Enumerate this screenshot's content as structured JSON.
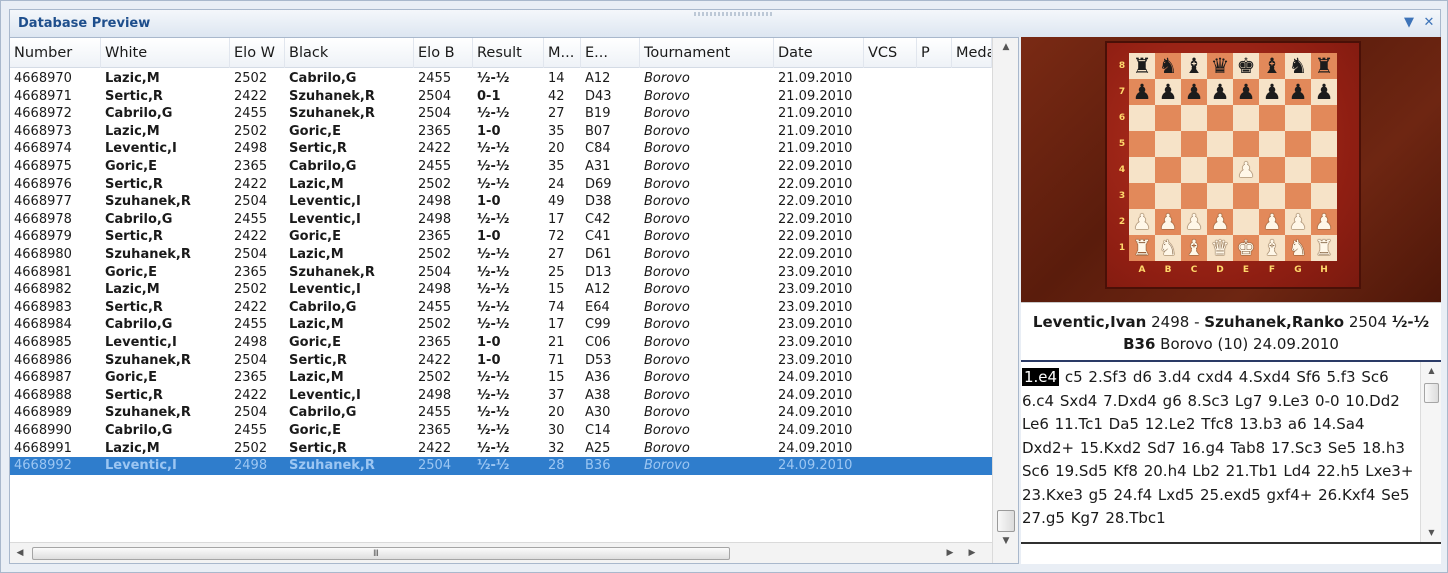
{
  "window": {
    "title": "Database Preview",
    "dropdown_icon": "▼",
    "close_icon": "✕"
  },
  "columns": [
    "Number",
    "White",
    "Elo W",
    "Black",
    "Elo B",
    "Result",
    "M...",
    "E...",
    "Tournament",
    "Date",
    "VCS",
    "P",
    "Meda"
  ],
  "rows": [
    [
      "4668970",
      "Lazic,M",
      "2502",
      "Cabrilo,G",
      "2455",
      "½-½",
      "14",
      "A12",
      "Borovo",
      "21.09.2010"
    ],
    [
      "4668971",
      "Sertic,R",
      "2422",
      "Szuhanek,R",
      "2504",
      "0-1",
      "42",
      "D43",
      "Borovo",
      "21.09.2010"
    ],
    [
      "4668972",
      "Cabrilo,G",
      "2455",
      "Szuhanek,R",
      "2504",
      "½-½",
      "27",
      "B19",
      "Borovo",
      "21.09.2010"
    ],
    [
      "4668973",
      "Lazic,M",
      "2502",
      "Goric,E",
      "2365",
      "1-0",
      "35",
      "B07",
      "Borovo",
      "21.09.2010"
    ],
    [
      "4668974",
      "Leventic,I",
      "2498",
      "Sertic,R",
      "2422",
      "½-½",
      "20",
      "C84",
      "Borovo",
      "21.09.2010"
    ],
    [
      "4668975",
      "Goric,E",
      "2365",
      "Cabrilo,G",
      "2455",
      "½-½",
      "35",
      "A31",
      "Borovo",
      "22.09.2010"
    ],
    [
      "4668976",
      "Sertic,R",
      "2422",
      "Lazic,M",
      "2502",
      "½-½",
      "24",
      "D69",
      "Borovo",
      "22.09.2010"
    ],
    [
      "4668977",
      "Szuhanek,R",
      "2504",
      "Leventic,I",
      "2498",
      "1-0",
      "49",
      "D38",
      "Borovo",
      "22.09.2010"
    ],
    [
      "4668978",
      "Cabrilo,G",
      "2455",
      "Leventic,I",
      "2498",
      "½-½",
      "17",
      "C42",
      "Borovo",
      "22.09.2010"
    ],
    [
      "4668979",
      "Sertic,R",
      "2422",
      "Goric,E",
      "2365",
      "1-0",
      "72",
      "C41",
      "Borovo",
      "22.09.2010"
    ],
    [
      "4668980",
      "Szuhanek,R",
      "2504",
      "Lazic,M",
      "2502",
      "½-½",
      "27",
      "D61",
      "Borovo",
      "22.09.2010"
    ],
    [
      "4668981",
      "Goric,E",
      "2365",
      "Szuhanek,R",
      "2504",
      "½-½",
      "25",
      "D13",
      "Borovo",
      "23.09.2010"
    ],
    [
      "4668982",
      "Lazic,M",
      "2502",
      "Leventic,I",
      "2498",
      "½-½",
      "15",
      "A12",
      "Borovo",
      "23.09.2010"
    ],
    [
      "4668983",
      "Sertic,R",
      "2422",
      "Cabrilo,G",
      "2455",
      "½-½",
      "74",
      "E64",
      "Borovo",
      "23.09.2010"
    ],
    [
      "4668984",
      "Cabrilo,G",
      "2455",
      "Lazic,M",
      "2502",
      "½-½",
      "17",
      "C99",
      "Borovo",
      "23.09.2010"
    ],
    [
      "4668985",
      "Leventic,I",
      "2498",
      "Goric,E",
      "2365",
      "1-0",
      "21",
      "C06",
      "Borovo",
      "23.09.2010"
    ],
    [
      "4668986",
      "Szuhanek,R",
      "2504",
      "Sertic,R",
      "2422",
      "1-0",
      "71",
      "D53",
      "Borovo",
      "23.09.2010"
    ],
    [
      "4668987",
      "Goric,E",
      "2365",
      "Lazic,M",
      "2502",
      "½-½",
      "15",
      "A36",
      "Borovo",
      "24.09.2010"
    ],
    [
      "4668988",
      "Sertic,R",
      "2422",
      "Leventic,I",
      "2498",
      "½-½",
      "37",
      "A38",
      "Borovo",
      "24.09.2010"
    ],
    [
      "4668989",
      "Szuhanek,R",
      "2504",
      "Cabrilo,G",
      "2455",
      "½-½",
      "20",
      "A30",
      "Borovo",
      "24.09.2010"
    ],
    [
      "4668990",
      "Cabrilo,G",
      "2455",
      "Goric,E",
      "2365",
      "½-½",
      "30",
      "C14",
      "Borovo",
      "24.09.2010"
    ],
    [
      "4668991",
      "Lazic,M",
      "2502",
      "Sertic,R",
      "2422",
      "½-½",
      "32",
      "A25",
      "Borovo",
      "24.09.2010"
    ],
    [
      "4668992",
      "Leventic,I",
      "2498",
      "Szuhanek,R",
      "2504",
      "½-½",
      "28",
      "B36",
      "Borovo",
      "24.09.2010"
    ]
  ],
  "selected_row": 22,
  "scroll": {
    "up_arrow": "▲",
    "down_arrow": "▼",
    "left_arrow": "◀",
    "right_arrow": "▶",
    "right_arrow2": "▶",
    "grip": "III"
  },
  "board": {
    "ranks": [
      "8",
      "7",
      "6",
      "5",
      "4",
      "3",
      "2",
      "1"
    ],
    "files": [
      "A",
      "B",
      "C",
      "D",
      "E",
      "F",
      "G",
      "H"
    ],
    "position": [
      [
        "bR",
        "bN",
        "bB",
        "bQ",
        "bK",
        "bB",
        "bN",
        "bR"
      ],
      [
        "bP",
        "bP",
        "bP",
        "bP",
        "bP",
        "bP",
        "bP",
        "bP"
      ],
      [
        "",
        "",
        "",
        "",
        "",
        "",
        "",
        ""
      ],
      [
        "",
        "",
        "",
        "",
        "",
        "",
        "",
        ""
      ],
      [
        "",
        "",
        "",
        "",
        "wP",
        "",
        "",
        ""
      ],
      [
        "",
        "",
        "",
        "",
        "",
        "",
        "",
        ""
      ],
      [
        "wP",
        "wP",
        "wP",
        "wP",
        "",
        "wP",
        "wP",
        "wP"
      ],
      [
        "wR",
        "wN",
        "wB",
        "wQ",
        "wK",
        "wB",
        "wN",
        "wR"
      ]
    ]
  },
  "game": {
    "white_name": "Leventic,Ivan",
    "white_elo": "2498",
    "separator": "-",
    "black_name": "Szuhanek,Ranko",
    "black_elo": "2504",
    "result": "½-½",
    "eco": "B36",
    "event": "Borovo (10) 24.09.2010"
  },
  "notation": {
    "current_move": "1.e4",
    "moves": "c5 2.Sf3 d6 3.d4 cxd4 4.Sxd4 Sf6 5.f3 Sc6 6.c4 Sxd4 7.Dxd4 g6 8.Sc3 Lg7 9.Le3 0-0 10.Dd2 Le6 11.Tc1 Da5 12.Le2 Tfc8 13.b3 a6 14.Sa4 Dxd2+ 15.Kxd2 Sd7 16.g4 Tab8 17.Sc3 Se5 18.h3 Sc6 19.Sd5 Kf8 20.h4 Lb2 21.Tb1 Ld4 22.h5 Lxe3+ 23.Kxe3 g5 24.f4 Lxd5 25.exd5 gxf4+ 26.Kxf4 Se5 27.g5 Kg7 28.Tbc1"
  },
  "colors": {
    "title": "#1e4e8c",
    "selection": "#2f7dcc",
    "light_square": "#f6e3c8",
    "dark_square": "#e2895a",
    "board_frame": "#a22818"
  }
}
